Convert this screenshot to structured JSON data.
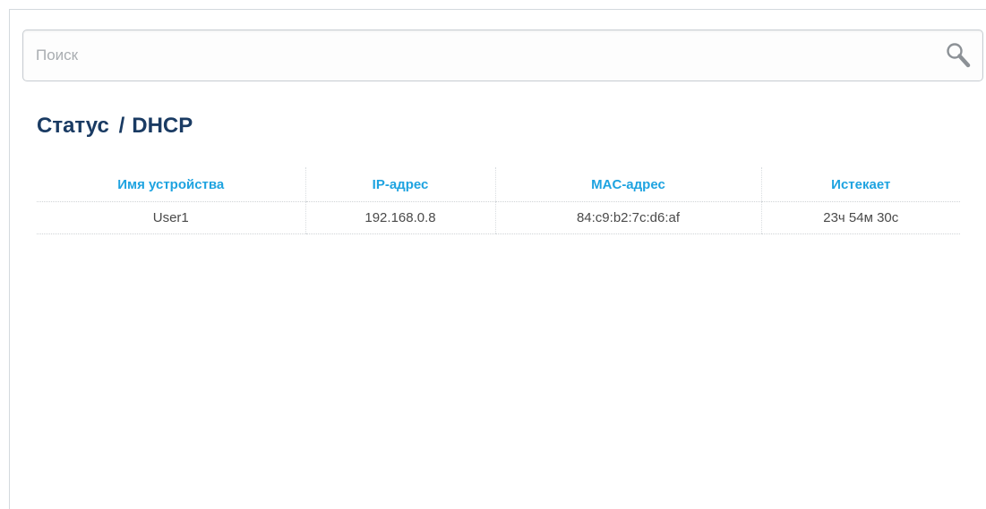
{
  "search": {
    "placeholder": "Поиск",
    "value": ""
  },
  "breadcrumb": {
    "section": "Статус",
    "separator": "/",
    "page": "DHCP"
  },
  "table": {
    "headers": [
      "Имя устройства",
      "IP-адрес",
      "MAC-адрес",
      "Истекает"
    ],
    "rows": [
      [
        "User1",
        "192.168.0.8",
        "84:c9:b2:7c:d6:af",
        "23ч 54м 30с"
      ]
    ]
  },
  "colors": {
    "title": "#1a3b63",
    "header": "#1ea3e0",
    "cell_text": "#4a4a4a"
  },
  "icons": {
    "search": "search-icon"
  }
}
